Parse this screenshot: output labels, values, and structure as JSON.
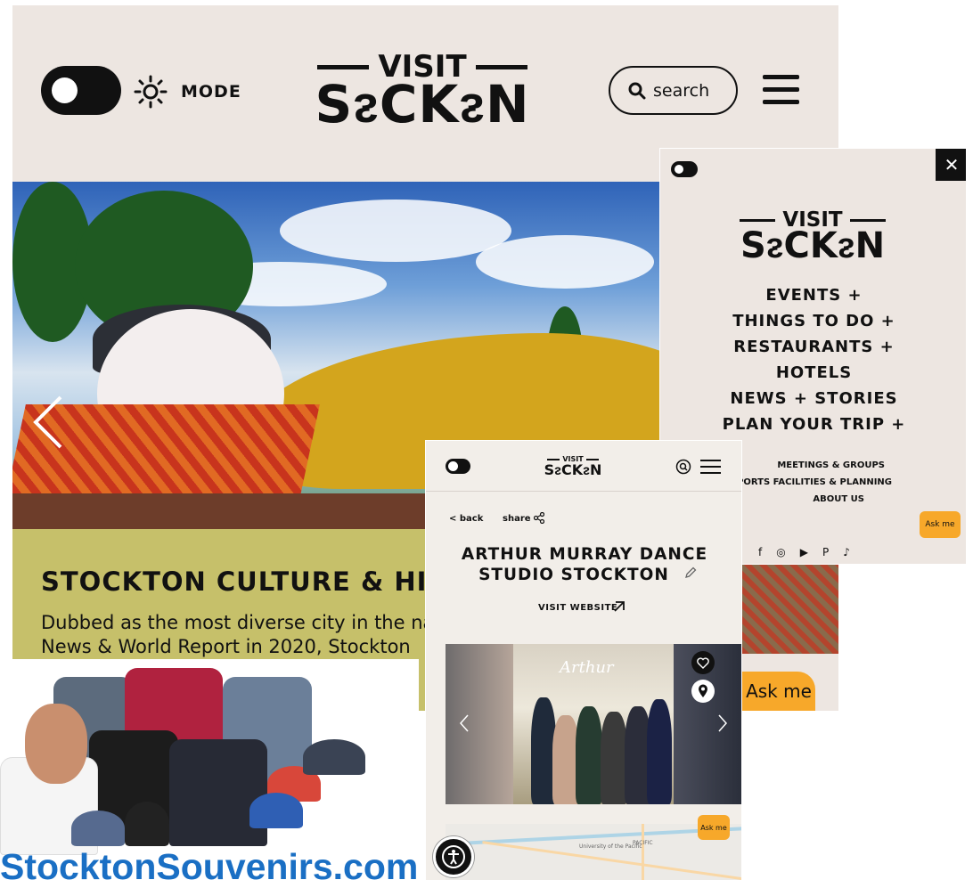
{
  "desktop": {
    "mode_label": "MODE",
    "logo": {
      "top": "VISIT",
      "bottom": "SᴤCKᴤN"
    },
    "search_label": "search",
    "hero_caption_title": "STOCKTON CULTURE & HIS",
    "hero_caption_text": "Dubbed as the most diverse city in the na News & World Report in 2020, Stockton"
  },
  "merch": {
    "site_text": "StocktonSouvenirs.com"
  },
  "menu_overlay": {
    "close_label": "✕",
    "logo": {
      "top": "VISIT",
      "bottom": "SᴤCKᴤN"
    },
    "main_items": [
      "EVENTS +",
      "THINGS TO DO +",
      "RESTAURANTS +",
      "HOTELS",
      "NEWS + STORIES",
      "PLAN YOUR TRIP +"
    ],
    "sub_items": [
      "MEETINGS & GROUPS",
      "PORTS FACILITIES & PLANNING",
      "ABOUT US"
    ],
    "ask_label": "Ask me",
    "social": [
      "f",
      "◎",
      "▶",
      "P",
      "♪"
    ]
  },
  "peek": {
    "ask_label": "Ask me"
  },
  "phone": {
    "logo": {
      "top": "VISIT",
      "bottom": "SᴤCKᴤN"
    },
    "back_label": "< back",
    "share_label": "share",
    "title_line1": "ARTHUR MURRAY DANCE",
    "title_line2": "STUDIO STOCKTON",
    "visit_website": "VISIT WEBSITE",
    "photo_label": "Arthur",
    "ask_label": "Ask me",
    "map_labels": [
      "University of the Pacific",
      "PACIFIC"
    ]
  },
  "colors": {
    "page_bg": "#ede6e1",
    "culture_band": "#c6c06a",
    "ask_orange": "#f7a82a",
    "souvenir_blue": "#1a6fc4"
  },
  "icons": [
    "toggle-icon",
    "sun-icon",
    "search-icon",
    "hamburger-icon",
    "chevron-left-icon",
    "close-icon",
    "share-icon",
    "pencil-icon",
    "arrow-up-right-icon",
    "heart-icon",
    "map-pin-icon",
    "accessibility-icon"
  ]
}
